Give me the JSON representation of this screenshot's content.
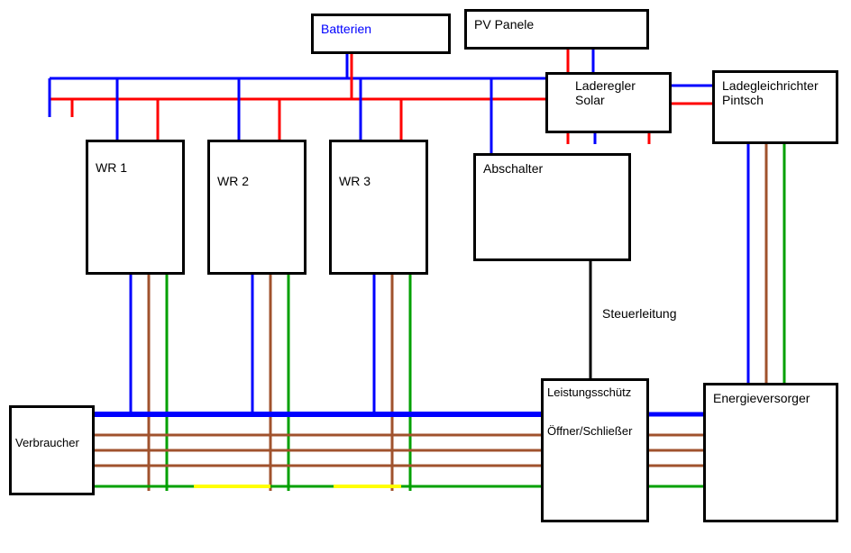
{
  "boxes": {
    "batterien": "Batterien",
    "pv_panele": "PV Panele",
    "laderegler_solar_l1": "Laderegler",
    "laderegler_solar_l2": "Solar",
    "ladegleichrichter_l1": "Ladegleichrichter",
    "ladegleichrichter_l2": "Pintsch",
    "wr1": "WR 1",
    "wr2": "WR 2",
    "wr3": "WR 3",
    "abschalter": "Abschalter",
    "steuerleitung": "Steuerleitung",
    "leistungsschuetz": "Leistungsschütz",
    "oeffner_schliesser": "Öffner/Schließer",
    "energieversorger": "Energieversorger",
    "verbraucher": "Verbraucher"
  },
  "colors": {
    "blue": "#0000ff",
    "red": "#ff0000",
    "brown": "#a0522d",
    "green": "#00a000",
    "yellow": "#ffff00",
    "black": "#000000"
  }
}
